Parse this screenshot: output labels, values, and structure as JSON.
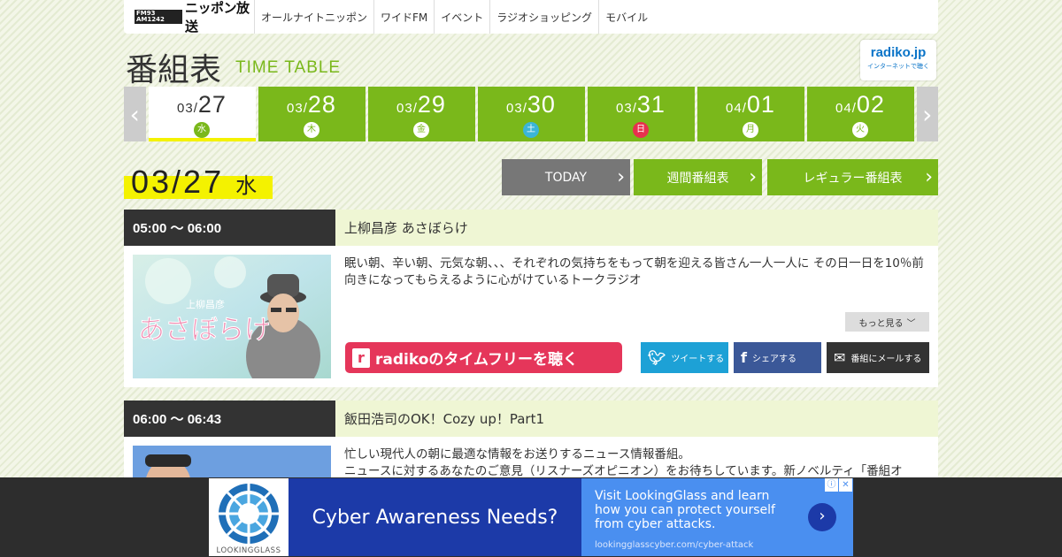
{
  "nav": {
    "logo_small": "FM93 AM1242",
    "logo": "ニッポン放送",
    "items": [
      "オールナイトニッポン",
      "ワイドFM",
      "イベント",
      "ラジオショッピング",
      "モバイル"
    ]
  },
  "header": {
    "title_jp": "番組表",
    "title_en": "TIME TABLE",
    "radiko_logo": "radiko.jp",
    "radiko_sub": "インターネットで聴く"
  },
  "dates": [
    {
      "month": "03/",
      "day": "27",
      "weekday": "水",
      "type": "weekday",
      "active": true
    },
    {
      "month": "03/",
      "day": "28",
      "weekday": "木",
      "type": "weekday"
    },
    {
      "month": "03/",
      "day": "29",
      "weekday": "金",
      "type": "weekday"
    },
    {
      "month": "03/",
      "day": "30",
      "weekday": "土",
      "type": "sat"
    },
    {
      "month": "03/",
      "day": "31",
      "weekday": "日",
      "type": "sun"
    },
    {
      "month": "04/",
      "day": "01",
      "weekday": "月",
      "type": "weekday"
    },
    {
      "month": "04/",
      "day": "02",
      "weekday": "火",
      "type": "weekday"
    }
  ],
  "current": {
    "date": "03/27",
    "weekday": "水"
  },
  "buttons": {
    "today": "TODAY",
    "weekly": "週間番組表",
    "regular": "レギュラー番組表"
  },
  "programs": [
    {
      "time": "05:00 ～ 06:00",
      "title": "上柳昌彦 あさぼらけ",
      "desc": "眠い朝、辛い朝、元気な朝、、、それぞれの気持ちをもって朝を迎える皆さん一人一人に その日一日を10％前向きになってもらえるように心がけているトークラジオ",
      "thumb_text": "あさぼらけ",
      "thumb_small": "上柳昌彦",
      "more": "もっと見る",
      "radiko": "radikoのタイムフリーを聴く",
      "tweet": "ツイートする",
      "share": "シェアする",
      "mail": "番組にメールする"
    },
    {
      "time": "06:00 ～ 06:43",
      "title": "飯田浩司のOK！Cozy up！Part1",
      "desc": "忙しい現代人の朝に最適な情報をお送りするニュース情報番組。\nニュースに対するあなたのご意見（リスナーズオピニオン）をお待ちしています。新ノベルティ「番組オ"
    }
  ],
  "ad": {
    "brand": "LOOKINGGLASS",
    "headline": "Cyber Awareness Needs?",
    "copy": "Visit LookingGlass and learn how you can protect yourself from cyber attacks.",
    "url": "lookingglasscyber.com/cyber-attack"
  },
  "colors": {
    "green": "#7ab81b",
    "yellow": "#f4f200",
    "radiko_pink": "#e5365a",
    "twitter": "#1da1d6",
    "facebook": "#3b5898"
  }
}
